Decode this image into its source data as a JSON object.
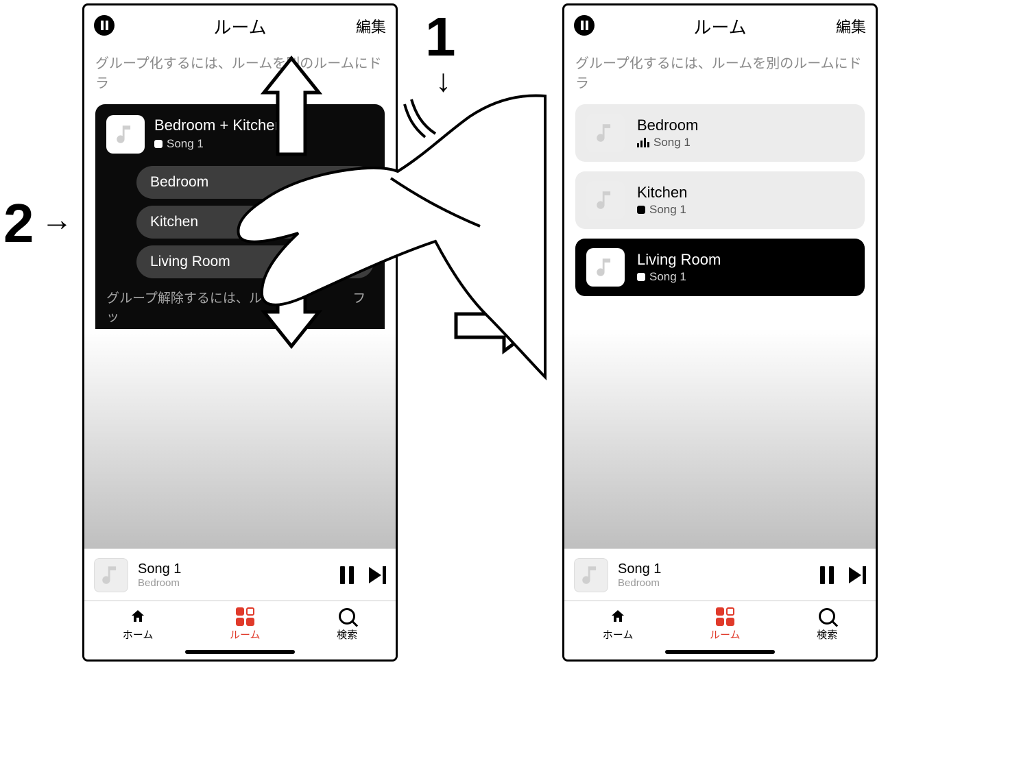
{
  "annotations": {
    "step1": "1",
    "step2": "2"
  },
  "left": {
    "header": {
      "title": "ルーム",
      "edit": "編集"
    },
    "hint": "グループ化するには、ルームを別のルームにドラ",
    "group": {
      "title": "Bedroom + Kitchen + ʟ",
      "song": "Song 1",
      "rooms": [
        "Bedroom",
        "Kitchen",
        "Living Room"
      ],
      "footer": "グループ解除するには、ルームを　　　　フッ"
    },
    "nowplaying": {
      "title": "Song 1",
      "room": "Bedroom"
    },
    "tabs": {
      "home": "ホーム",
      "rooms": "ルーム",
      "search": "検索"
    }
  },
  "right": {
    "header": {
      "title": "ルーム",
      "edit": "編集"
    },
    "hint": "グループ化するには、ルームを別のルームにドラ",
    "rooms": [
      {
        "name": "Bedroom",
        "song": "Song 1",
        "playing": true,
        "dark": false
      },
      {
        "name": "Kitchen",
        "song": "Song 1",
        "playing": false,
        "dark": false
      },
      {
        "name": "Living Room",
        "song": "Song 1",
        "playing": false,
        "dark": true
      }
    ],
    "nowplaying": {
      "title": "Song 1",
      "room": "Bedroom"
    },
    "tabs": {
      "home": "ホーム",
      "rooms": "ルーム",
      "search": "検索"
    }
  }
}
